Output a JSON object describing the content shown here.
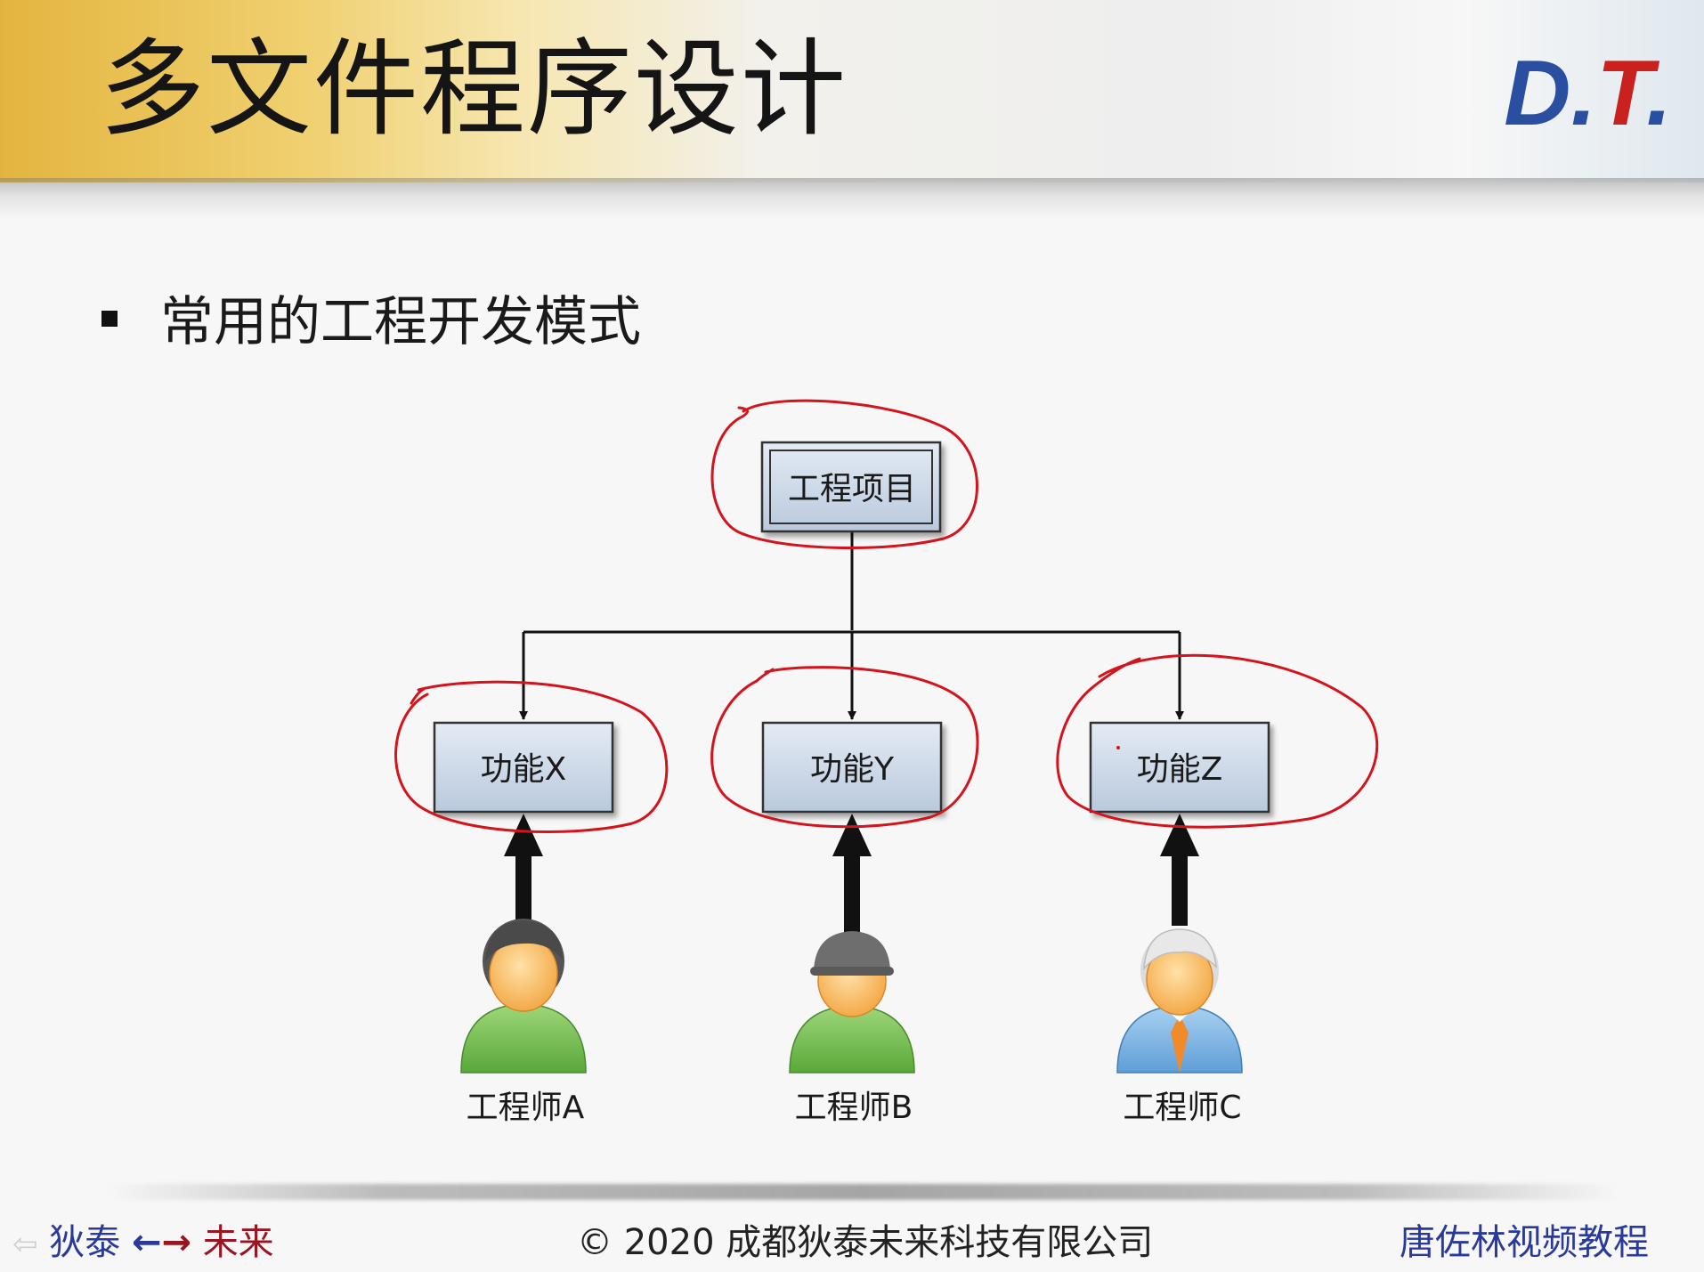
{
  "header": {
    "title": "多文件程序设计",
    "logo": {
      "d": "D",
      "dot1": ".",
      "t": "T",
      "dot2": "."
    }
  },
  "content": {
    "bullet_text": "常用的工程开发模式"
  },
  "diagram": {
    "root": "工程项目",
    "modules": [
      "功能X",
      "功能Y",
      "功能Z"
    ],
    "engineers": [
      "工程师A",
      "工程师B",
      "工程师C"
    ],
    "annotation_color": "#d4141c"
  },
  "footer": {
    "left_prev_icon": "left-arrow-icon",
    "left_part1": "狄泰",
    "left_arrow_left": "←",
    "left_arrow_right": "→",
    "left_part2": "未来",
    "center": "© 2020 成都狄泰未来科技有限公司",
    "right": "唐佐林视频教程"
  }
}
